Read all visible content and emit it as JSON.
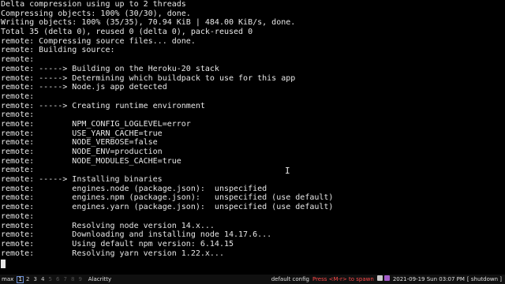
{
  "terminal": {
    "lines": [
      "Delta compression using up to 2 threads",
      "Compressing objects: 100% (30/30), done.",
      "Writing objects: 100% (35/35), 70.94 KiB | 484.00 KiB/s, done.",
      "Total 35 (delta 0), reused 0 (delta 0), pack-reused 0",
      "remote: Compressing source files... done.",
      "remote: Building source:",
      "remote:",
      "remote: -----> Building on the Heroku-20 stack",
      "remote: -----> Determining which buildpack to use for this app",
      "remote: -----> Node.js app detected",
      "remote:",
      "remote: -----> Creating runtime environment",
      "remote:",
      "remote:        NPM_CONFIG_LOGLEVEL=error",
      "remote:        USE_YARN_CACHE=true",
      "remote:        NODE_VERBOSE=false",
      "remote:        NODE_ENV=production",
      "remote:        NODE_MODULES_CACHE=true",
      "remote:",
      "remote: -----> Installing binaries",
      "remote:        engines.node (package.json):  unspecified",
      "remote:        engines.npm (package.json):   unspecified (use default)",
      "remote:        engines.yarn (package.json):  unspecified (use default)",
      "remote:",
      "remote:        Resolving node version 14.x...",
      "remote:        Downloading and installing node 14.17.6...",
      "remote:        Using default npm version: 6.14.15",
      "remote:        Resolving yarn version 1.22.x..."
    ]
  },
  "statusbar": {
    "layout": "max",
    "workspaces": [
      {
        "label": "1",
        "state": "active"
      },
      {
        "label": "2",
        "state": "normal"
      },
      {
        "label": "3",
        "state": "normal"
      },
      {
        "label": "4",
        "state": "normal"
      },
      {
        "label": "5",
        "state": "dim"
      },
      {
        "label": "6",
        "state": "dim"
      },
      {
        "label": "7",
        "state": "dim"
      },
      {
        "label": "8",
        "state": "dim"
      },
      {
        "label": "9",
        "state": "dim"
      }
    ],
    "window_title": "Alacritty",
    "config_name": "default config",
    "spawn_hint": "Press <M-r> to spawn",
    "tray_icons": [
      {
        "name": "terminal-tray-icon",
        "color": "#c8c8c8"
      },
      {
        "name": "clock-tray-icon",
        "color": "#a35cc8"
      }
    ],
    "datetime": "2021-09-19 Sun 03:07 PM",
    "shutdown_label": "[ shutdown ]"
  },
  "colors": {
    "background": "#000000",
    "foreground": "#e8e8e8",
    "bar_background": "#101010",
    "active_workspace_border": "#6a8fd8",
    "spawn_hint": "#ff4b4b"
  }
}
